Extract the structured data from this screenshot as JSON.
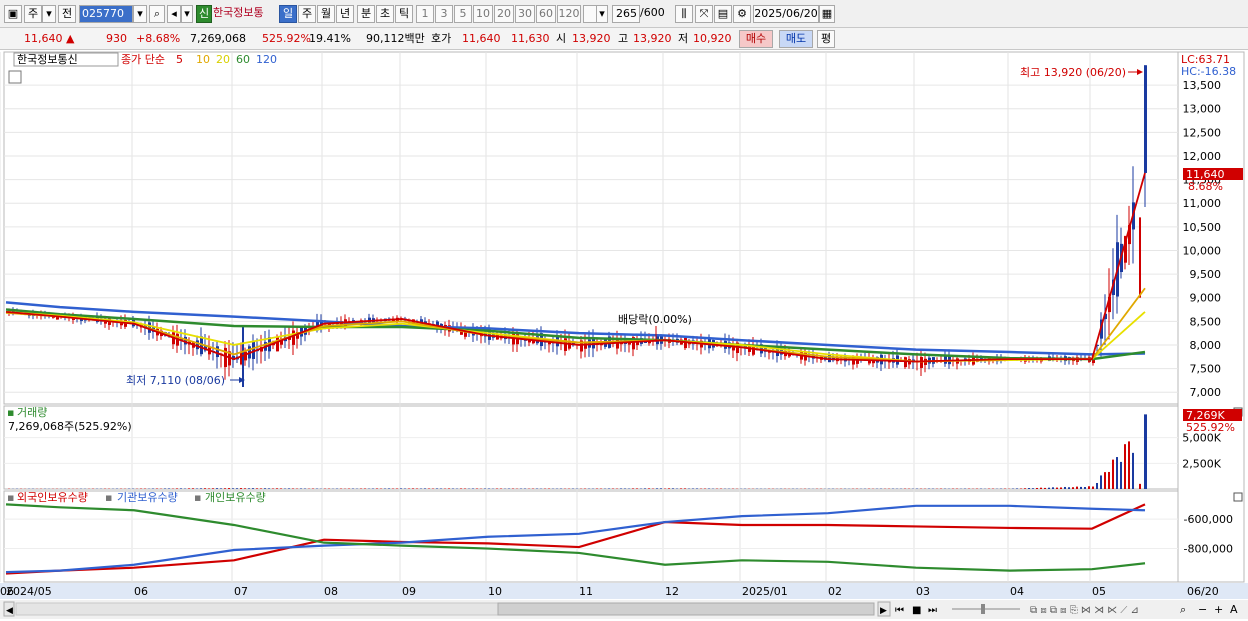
{
  "toolbar": {
    "period_main": "주",
    "prev_label": "전",
    "code": "025770",
    "badge": "신",
    "stock_name": "한국정보통",
    "periods": [
      "일",
      "주",
      "월",
      "년",
      "분",
      "초",
      "틱"
    ],
    "selected_period": "일",
    "intervals": [
      "1",
      "3",
      "5",
      "10",
      "20",
      "30",
      "60",
      "120"
    ],
    "count": "265",
    "count_total": "/600",
    "date": "2025/06/20"
  },
  "quote": {
    "price": "11,640",
    "arrow": "▲",
    "change": "930",
    "change_pct": "+8.68%",
    "volume": "7,269,068",
    "volume_pct": "525.92%",
    "turnover": "19.41%",
    "amount": "90,112백만",
    "hoga_label": "호가",
    "ask": "11,640",
    "bid": "11,630",
    "open_label": "시",
    "open": "13,920",
    "high_label": "고",
    "high": "13,920",
    "low_label": "저",
    "low": "10,920",
    "buy_label": "매수",
    "sell_label": "매도",
    "eval_label": "평"
  },
  "price_panel": {
    "name": "한국정보통신",
    "ma_caption": "종가 단순",
    "ma_periods": [
      "5",
      "10",
      "20",
      "60",
      "120"
    ],
    "ma_colors": [
      "#d00000",
      "#e0a800",
      "#e8e000",
      "#2e8b2e",
      "#3060d0"
    ],
    "lc": "LC:63.71",
    "hc": "HC:-16.38",
    "last_price": "11,640",
    "last_pct": "8.68%",
    "high_note": "최고 13,920 (06/20)",
    "low_note": "최저 7,110 (08/06)",
    "event_note": "배당락(0.00%)"
  },
  "volume_panel": {
    "title": "거래량",
    "value": "7,269,068주(525.92%)",
    "last": "7,269K",
    "last_pct": "525.92%"
  },
  "holding_panel": {
    "legend": [
      "외국인보유수량",
      "기관보유수량",
      "개인보유수량"
    ],
    "colors": [
      "#d00000",
      "#3060d0",
      "#2e8b2e"
    ]
  },
  "x_axis_labels": [
    "2024/05",
    "06",
    "07",
    "08",
    "09",
    "10",
    "11",
    "12",
    "2025/01",
    "02",
    "03",
    "04",
    "05",
    "06"
  ],
  "x_last": "06/20",
  "chart_data": [
    {
      "type": "line",
      "title": "",
      "y_ticks": [
        "7,000",
        "7,500",
        "8,000",
        "8,500",
        "9,000",
        "9,500",
        "10,000",
        "10,500",
        "11,000",
        "11,500",
        "12,000",
        "12,500",
        "13,000",
        "13,500"
      ],
      "ylim": [
        6750,
        14200
      ],
      "x": [
        "2024/05",
        "06",
        "07",
        "08",
        "09",
        "10",
        "11",
        "12",
        "2025/01",
        "02",
        "03",
        "04",
        "05",
        "06",
        "06/20"
      ],
      "series": [
        {
          "name": "5",
          "values": [
            8700,
            8600,
            8450,
            7700,
            8450,
            8550,
            8200,
            8000,
            8100,
            7950,
            7700,
            7650,
            7700,
            7700,
            11640
          ]
        },
        {
          "name": "10",
          "values": [
            8680,
            8600,
            8450,
            7800,
            8400,
            8500,
            8200,
            8050,
            8100,
            7950,
            7750,
            7650,
            7700,
            7700,
            9200
          ]
        },
        {
          "name": "20",
          "values": [
            8700,
            8620,
            8480,
            8000,
            8350,
            8450,
            8250,
            8050,
            8100,
            8000,
            7800,
            7650,
            7680,
            7700,
            8700
          ]
        },
        {
          "name": "60",
          "values": [
            8750,
            8650,
            8550,
            8400,
            8380,
            8380,
            8300,
            8150,
            8100,
            8000,
            7900,
            7800,
            7720,
            7700,
            7850
          ]
        },
        {
          "name": "120",
          "values": [
            8900,
            8800,
            8700,
            8600,
            8500,
            8400,
            8350,
            8250,
            8200,
            8100,
            8000,
            7900,
            7850,
            7800,
            7820
          ]
        }
      ],
      "candles_high": [
        8850,
        8750,
        8700,
        8700,
        8700,
        8650,
        8600,
        8500,
        8350,
        8300,
        8200,
        8150,
        8500,
        8500,
        13920
      ],
      "candles_low": [
        8450,
        8400,
        8200,
        7110,
        8100,
        8150,
        7900,
        7600,
        7800,
        7600,
        7500,
        7300,
        7600,
        7500,
        7500
      ]
    },
    {
      "type": "bar",
      "title": "",
      "y_ticks": [
        "2,500K",
        "5,000K"
      ],
      "ylim": [
        0,
        7500
      ],
      "x": [
        "2024/05",
        "06",
        "07",
        "08",
        "09",
        "10",
        "11",
        "12",
        "2025/01",
        "02",
        "03",
        "04",
        "05",
        "06",
        "06/20"
      ],
      "values": [
        30,
        25,
        40,
        90,
        40,
        60,
        50,
        40,
        70,
        30,
        30,
        40,
        40,
        280,
        7269
      ]
    },
    {
      "type": "line",
      "title": "",
      "y_ticks": [
        "-600,000",
        "-800,000"
      ],
      "ylim": [
        -1000000,
        -450000
      ],
      "x": [
        "2024/05",
        "06",
        "07",
        "08",
        "09",
        "10",
        "11",
        "12",
        "2025/01",
        "02",
        "03",
        "04",
        "05",
        "06",
        "06/20"
      ],
      "series": [
        {
          "name": "외국인보유수량",
          "values": [
            -970000,
            -950000,
            -930000,
            -880000,
            -740000,
            -755000,
            -765000,
            -790000,
            -620000,
            -640000,
            -640000,
            -650000,
            -660000,
            -665000,
            -500000
          ]
        },
        {
          "name": "기관보유수량",
          "values": [
            -960000,
            -950000,
            -910000,
            -810000,
            -780000,
            -760000,
            -720000,
            -700000,
            -620000,
            -580000,
            -560000,
            -510000,
            -510000,
            -530000,
            -540000
          ]
        },
        {
          "name": "개인보유수량",
          "values": [
            -500000,
            -520000,
            -540000,
            -640000,
            -760000,
            -780000,
            -800000,
            -830000,
            -910000,
            -880000,
            -890000,
            -930000,
            -950000,
            -940000,
            -900000
          ]
        }
      ]
    }
  ]
}
